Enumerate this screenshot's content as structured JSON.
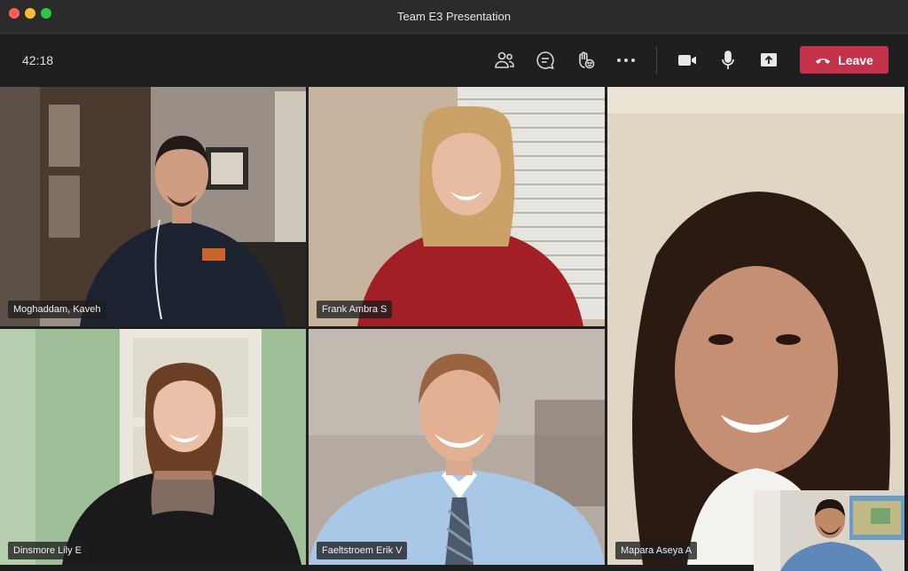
{
  "window": {
    "title": "Team E3 Presentation"
  },
  "toolbar": {
    "timer": "42:18",
    "icons": [
      "people-icon",
      "chat-icon",
      "raise-hand-icon",
      "more-icon",
      "camera-icon",
      "mic-icon",
      "share-icon"
    ],
    "leave_label": "Leave",
    "leave_color": "#c4314b"
  },
  "participants": [
    {
      "name": "Moghaddam, Kaveh"
    },
    {
      "name": "Frank Ambra S"
    },
    {
      "name": "Mapara Aseya A"
    },
    {
      "name": "Dinsmore Lily E"
    },
    {
      "name": "Faeltstroem Erik V"
    }
  ]
}
